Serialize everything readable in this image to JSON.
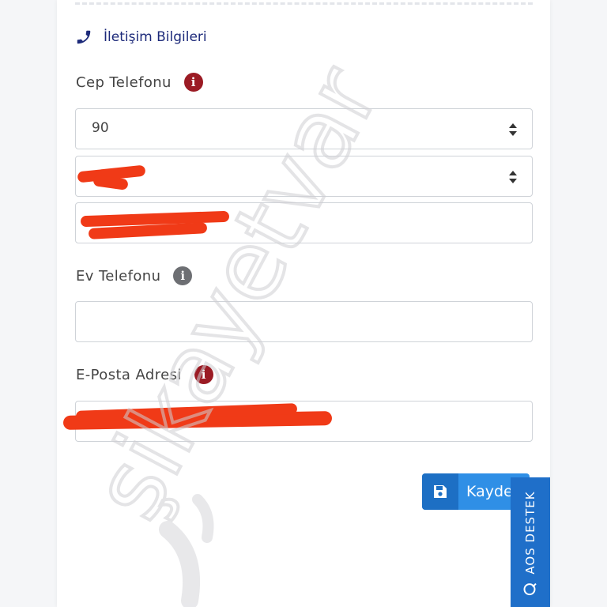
{
  "section": {
    "title": "İletişim Bilgileri",
    "icon": "phone-icon"
  },
  "fields": {
    "mobile": {
      "label": "Cep Telefonu",
      "country_code": "90",
      "info_icon": "info-icon",
      "info_color": "#9b1b24"
    },
    "home": {
      "label": "Ev Telefonu",
      "value": "",
      "info_icon": "info-icon",
      "info_color": "#6d6f73"
    },
    "email": {
      "label": "E-Posta Adresi",
      "info_icon": "info-icon",
      "info_color": "#9b1b24"
    }
  },
  "save_button": {
    "label": "Kaydet",
    "icon": "floppy-disk-icon",
    "color": "#2f8fe6"
  },
  "support_tab": {
    "label": "AOS DESTEK",
    "icon": "chat-bubble-icon",
    "color": "#1f6fc9"
  },
  "watermark": {
    "text": "şikayetvar"
  },
  "colors": {
    "heading": "#1d2a7a",
    "redaction": "#f03a17"
  }
}
